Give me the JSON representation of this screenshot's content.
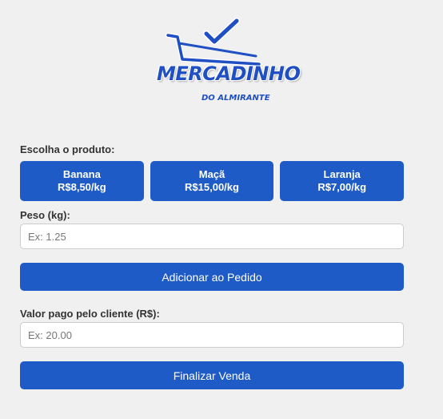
{
  "logo": {
    "title": "MERCADINHO",
    "subtitle": "DO ALMIRANTE",
    "icon": "shopping-cart-check-icon",
    "color": "#1f4fc2"
  },
  "product_section": {
    "label": "Escolha o produto:",
    "products": [
      {
        "name": "Banana",
        "price": "R$8,50/kg"
      },
      {
        "name": "Maçã",
        "price": "R$15,00/kg"
      },
      {
        "name": "Laranja",
        "price": "R$7,00/kg"
      }
    ]
  },
  "weight": {
    "label": "Peso (kg):",
    "placeholder": "Ex: 1.25",
    "value": ""
  },
  "add_button": {
    "label": "Adicionar ao Pedido"
  },
  "payment": {
    "label": "Valor pago pelo cliente (R$):",
    "placeholder": "Ex: 20.00",
    "value": ""
  },
  "finish_button": {
    "label": "Finalizar Venda"
  },
  "colors": {
    "accent": "#1e5bc6",
    "background": "#f0f0f0"
  }
}
